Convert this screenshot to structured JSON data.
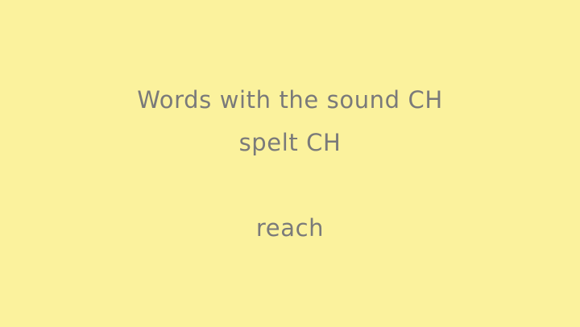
{
  "slide": {
    "background_color": "#fbf29d",
    "text_color": "#7a7a7a",
    "title_line_1": "Words with the sound CH",
    "title_line_2": "spelt CH",
    "word": "reach"
  }
}
